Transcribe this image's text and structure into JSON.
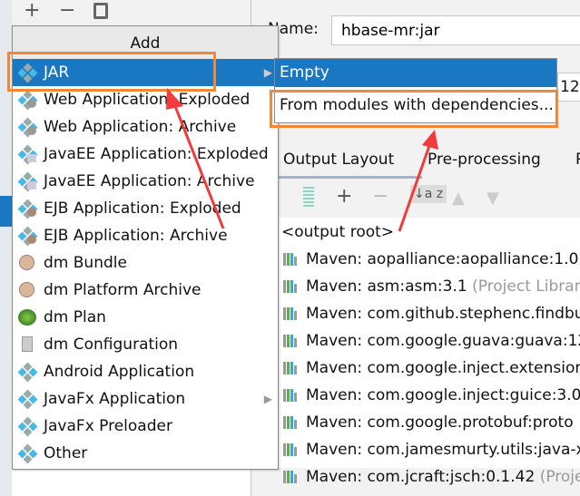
{
  "toolbar": {
    "add_icon": "+",
    "remove_icon": "−",
    "copy_icon": "copy-icon"
  },
  "form": {
    "name_label": "Name:",
    "name_value": "hbase-mr:jar",
    "type_fragment": "12"
  },
  "tabs": [
    {
      "label": "Output Layout"
    },
    {
      "label": "Pre-processing"
    },
    {
      "label": "P"
    }
  ],
  "output_toolbar": {
    "sort_icon": "↓a z",
    "add": "+",
    "remove": "−",
    "up": "▲",
    "down": "▼"
  },
  "output": {
    "root": "<output root>",
    "rows": [
      {
        "name": "Maven: aopalliance:aopalliance:1.0",
        "suffix": ""
      },
      {
        "name": "Maven: asm:asm:3.1",
        "suffix": "(Project Library"
      },
      {
        "name": "Maven: com.github.stephenc.findbu",
        "suffix": ""
      },
      {
        "name": "Maven: com.google.guava:guava:12",
        "suffix": ""
      },
      {
        "name": "Maven: com.google.inject.extension",
        "suffix": ""
      },
      {
        "name": "Maven: com.google.inject:guice:3.0",
        "suffix": ""
      },
      {
        "name": "Maven: com.google.protobuf:proto",
        "suffix": ""
      },
      {
        "name": "Maven: com.jamesmurty.utils:java-x",
        "suffix": ""
      },
      {
        "name": "Maven: com.jcraft:jsch:0.1.42",
        "suffix": "(Proje"
      }
    ]
  },
  "popup": {
    "title": "Add",
    "items": [
      {
        "label": "JAR",
        "icon": "artifact-icon",
        "submenu": true,
        "selected": true
      },
      {
        "label": "Web Application: Exploded",
        "icon": "web-icon"
      },
      {
        "label": "Web Application: Archive",
        "icon": "web-icon"
      },
      {
        "label": "JavaEE Application: Exploded",
        "icon": "javaee-icon"
      },
      {
        "label": "JavaEE Application: Archive",
        "icon": "javaee-icon"
      },
      {
        "label": "EJB Application: Exploded",
        "icon": "ejb-icon"
      },
      {
        "label": "EJB Application: Archive",
        "icon": "ejb-icon"
      },
      {
        "label": "dm Bundle",
        "icon": "bundle-icon"
      },
      {
        "label": "dm Platform Archive",
        "icon": "bundle-icon"
      },
      {
        "label": "dm Plan",
        "icon": "plan-icon"
      },
      {
        "label": "dm Configuration",
        "icon": "file-icon"
      },
      {
        "label": "Android Application",
        "icon": "artifact-icon"
      },
      {
        "label": "JavaFx Application",
        "icon": "artifact-icon",
        "submenu": true
      },
      {
        "label": "JavaFx Preloader",
        "icon": "artifact-icon"
      },
      {
        "label": "Other",
        "icon": "artifact-icon"
      }
    ]
  },
  "submenu": {
    "items": [
      {
        "label": "Empty"
      },
      {
        "label": "From modules with dependencies..."
      }
    ]
  },
  "colors": {
    "selection": "#1a78c2",
    "highlight": "#f0883a",
    "annotation_arrow": "#f03c3c"
  }
}
